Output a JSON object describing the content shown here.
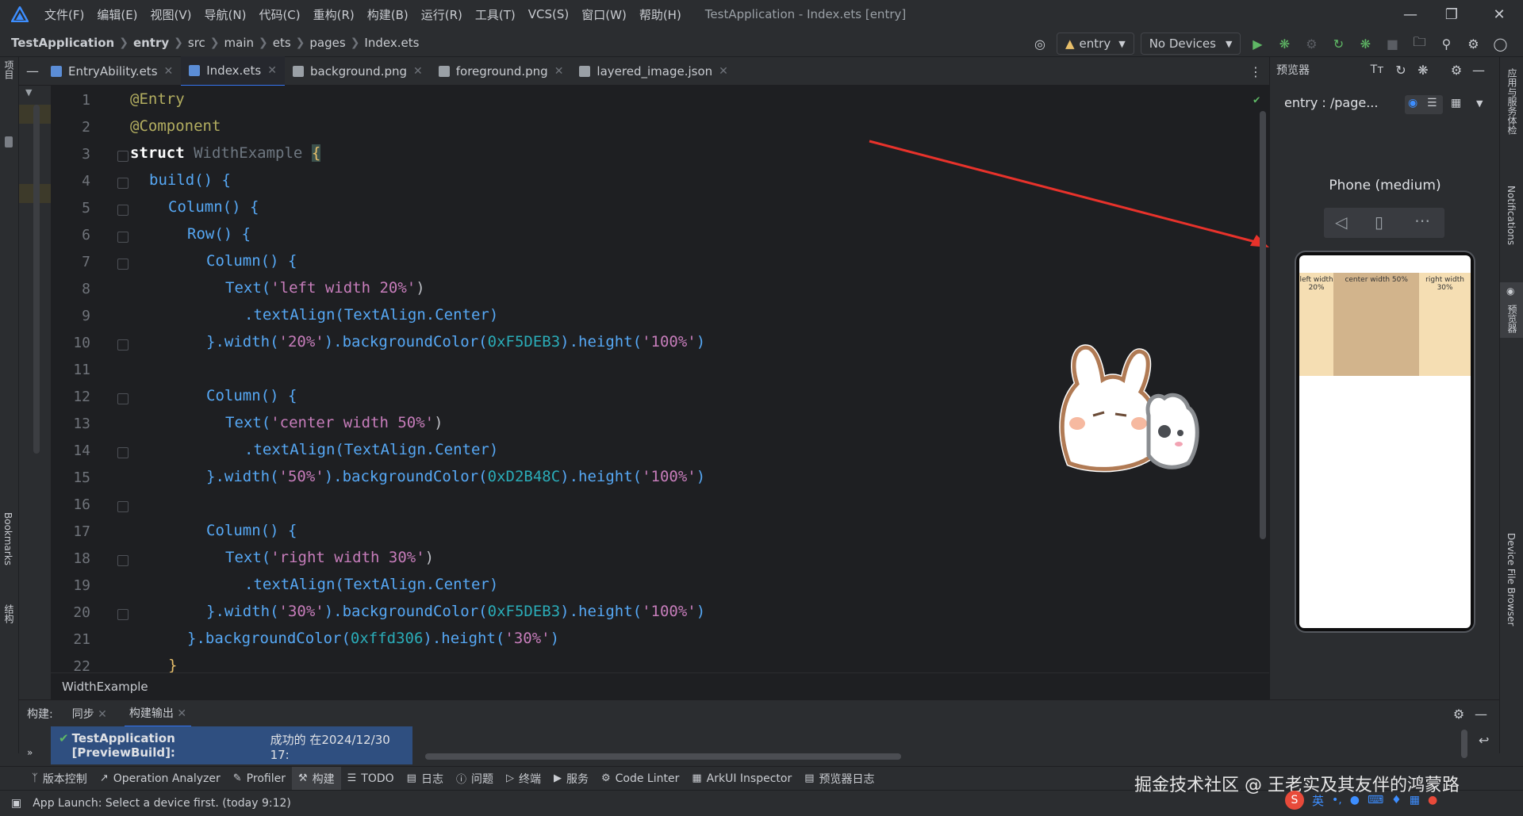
{
  "titlebar": {
    "menus": [
      "文件(F)",
      "编辑(E)",
      "视图(V)",
      "导航(N)",
      "代码(C)",
      "重构(R)",
      "构建(B)",
      "运行(R)",
      "工具(T)",
      "VCS(S)",
      "窗口(W)",
      "帮助(H)"
    ],
    "window_title": "TestApplication - Index.ets [entry]"
  },
  "navbar": {
    "breadcrumbs": [
      "TestApplication",
      "entry",
      "src",
      "main",
      "ets",
      "pages",
      "Index.ets"
    ],
    "module_select": "entry",
    "device_select": "No Devices"
  },
  "left_strip": {
    "project": "项目",
    "bookmarks": "Bookmarks",
    "structure": "结构"
  },
  "tabs": [
    {
      "label": "EntryAbility.ets",
      "icon_color": "#5b8dd6"
    },
    {
      "label": "Index.ets",
      "icon_color": "#5b8dd6"
    },
    {
      "label": "background.png",
      "icon_color": "#9aa0a6"
    },
    {
      "label": "foreground.png",
      "icon_color": "#9aa0a6"
    },
    {
      "label": "layered_image.json",
      "icon_color": "#9aa0a6"
    }
  ],
  "code": {
    "line_numbers": [
      "1",
      "2",
      "3",
      "4",
      "5",
      "6",
      "7",
      "8",
      "9",
      "10",
      "11",
      "12",
      "13",
      "14",
      "15",
      "16",
      "17",
      "18",
      "19",
      "20",
      "21",
      "22"
    ],
    "l1": "@Entry",
    "l2": "@Component",
    "l3_kw": "struct",
    "l3_name": "WidthExample",
    "l3_brace": "{",
    "l4": "build() {",
    "l5": "Column() {",
    "l6": "Row() {",
    "l7": "Column() {",
    "l8_fn": "Text(",
    "l8_str": "'left width 20%'",
    "l8_end": ")",
    "l9": ".textAlign(TextAlign.Center)",
    "l10_a": "}.width(",
    "l10_b": "'20%'",
    "l10_c": ").backgroundColor(",
    "l10_d": "0xF5DEB3",
    "l10_e": ").height(",
    "l10_f": "'100%'",
    "l10_g": ")",
    "l12": "Column() {",
    "l13_fn": "Text(",
    "l13_str": "'center width 50%'",
    "l13_end": ")",
    "l14": ".textAlign(TextAlign.Center)",
    "l15_a": "}.width(",
    "l15_b": "'50%'",
    "l15_c": ").backgroundColor(",
    "l15_d": "0xD2B48C",
    "l15_e": ").height(",
    "l15_f": "'100%'",
    "l15_g": ")",
    "l17": "Column() {",
    "l18_fn": "Text(",
    "l18_str": "'right width 30%'",
    "l18_end": ")",
    "l19": ".textAlign(TextAlign.Center)",
    "l20_a": "}.width(",
    "l20_b": "'30%'",
    "l20_c": ").backgroundColor(",
    "l20_d": "0xF5DEB3",
    "l20_e": ").height(",
    "l20_f": "'100%'",
    "l20_g": ")",
    "l21_a": "}.backgroundColor(",
    "l21_b": "0xffd306",
    "l21_c": ").height(",
    "l21_d": "'30%'",
    "l21_e": ")",
    "l22": "}"
  },
  "struct_crumb": "WidthExample",
  "preview": {
    "panel_title": "预览器",
    "route": "entry : /page...",
    "device": "Phone (medium)",
    "cells": [
      {
        "text": "left width 20%",
        "color": "#F5DEB3"
      },
      {
        "text": "center width 50%",
        "color": "#D2B48C"
      },
      {
        "text": "right width 30%",
        "color": "#F5DEB3"
      }
    ]
  },
  "right_strip": {
    "app_service": "应用与服务体检",
    "notifications": "Notifications",
    "previewer": "预览器",
    "device_file_browser": "Device File Browser"
  },
  "build": {
    "label": "构建:",
    "tab_sync": "同步",
    "tab_output": "构建输出",
    "msg_bold": "TestApplication [PreviewBuild]:",
    "msg_rest": " 成功的 在2024/12/30 17:"
  },
  "bottom_tools": [
    "版本控制",
    "Operation Analyzer",
    "Profiler",
    "构建",
    "TODO",
    "日志",
    "问题",
    "终端",
    "服务",
    "Code Linter",
    "ArkUI Inspector",
    "预览器日志"
  ],
  "status": {
    "text": "App Launch: Select a device first. (today 9:12)",
    "watermark": "掘金技术社区 @ 王老实及其友伴的鸿蒙路",
    "ime": "英"
  }
}
